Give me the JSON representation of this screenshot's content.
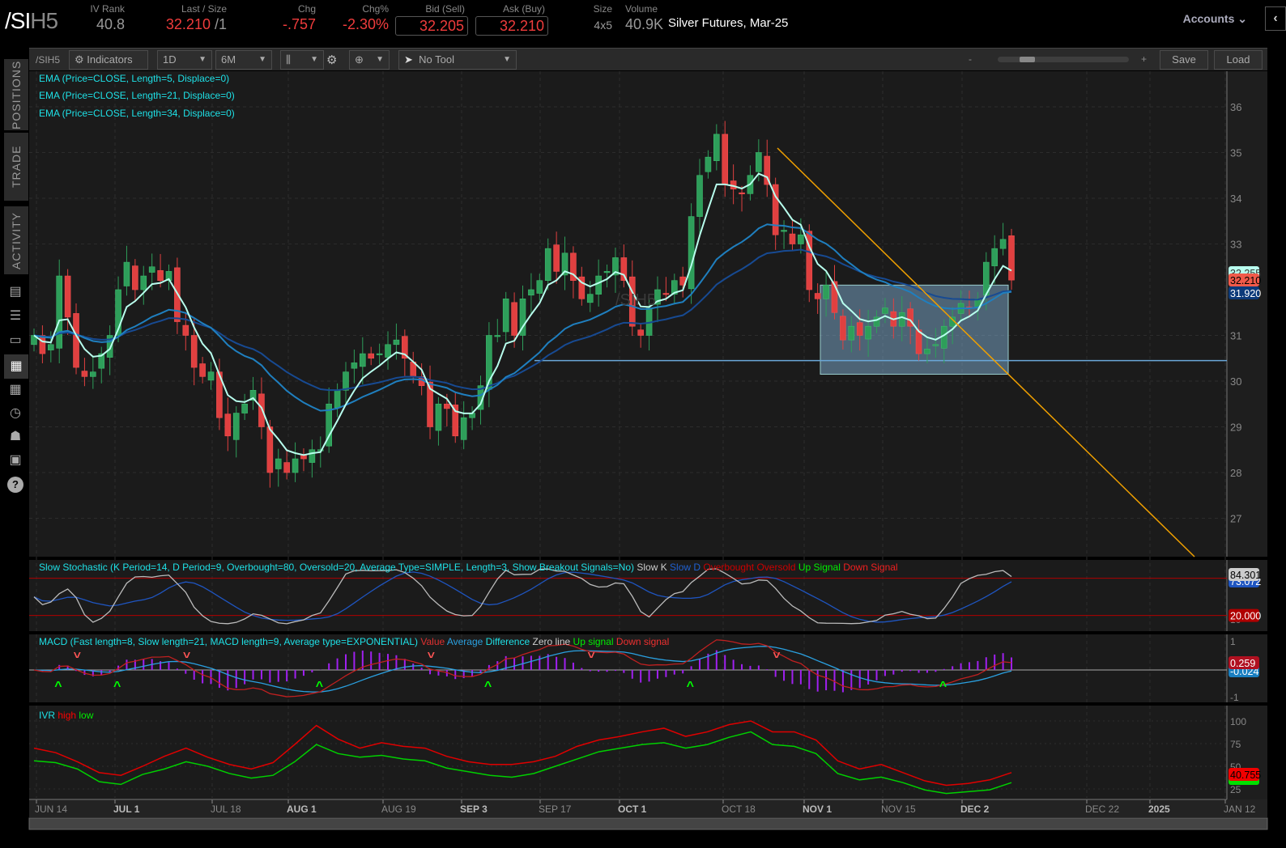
{
  "header": {
    "symbol_main": "/SI",
    "symbol_suffix": "H5",
    "fields": [
      {
        "label": "IV Rank",
        "value": "40.8"
      },
      {
        "label": "Last / Size",
        "value": "32.210",
        "size": "/1"
      },
      {
        "label": "Chg",
        "value": "-.757"
      },
      {
        "label": "Chg%",
        "value": "-2.30%"
      },
      {
        "label": "Bid (Sell)",
        "value": "32.205"
      },
      {
        "label": "Ask (Buy)",
        "value": "32.210"
      },
      {
        "label": "Size",
        "value": "4x5"
      },
      {
        "label": "Volume",
        "value": "40.9K"
      }
    ],
    "description": "Silver Futures, Mar-25",
    "accounts": "Accounts"
  },
  "sidebar": {
    "tabs": [
      "POSITIONS",
      "TRADE",
      "ACTIVITY"
    ],
    "icons": [
      "news-icon",
      "list-icon",
      "tv-icon",
      "chart-icon",
      "grid-icon",
      "clock-icon",
      "people-icon",
      "calendar-icon",
      "help-icon"
    ]
  },
  "toolbar": {
    "symbol": "/SIH5",
    "indicators": "Indicators",
    "period": "1D",
    "range": "6M",
    "tool": "No Tool",
    "zoom_minus": "-",
    "zoom_plus": "+",
    "save": "Save",
    "load": "Load",
    "zoom_level": 0.12
  },
  "studies": [
    "EMA (Price=CLOSE, Length=5, Displace=0)",
    "EMA (Price=CLOSE, Length=21, Displace=0)",
    "EMA (Price=CLOSE, Length=34, Displace=0)"
  ],
  "stoch": {
    "title": "Slow Stochastic (K Period=14, D Period=9, Overbought=80, Oversold=20, Average Type=SIMPLE, Length=3, Show Breakout Signals=No)",
    "legend": [
      "Slow K",
      "Slow D",
      "Overbought",
      "Oversold",
      "Up Signal",
      "Down Signal"
    ],
    "k_label": "84.301",
    "d_label": "73.072",
    "os_label": "20.000",
    "axis": [
      "10"
    ]
  },
  "macd": {
    "title": "MACD (Fast length=8, Slow length=21, MACD length=9, Average type=EXPONENTIAL)",
    "legend": [
      "Value",
      "Average",
      "Difference",
      "Zero line",
      "Up signal",
      "Down signal"
    ],
    "value_label": "0.259",
    "avg_label": "-0.024",
    "axis": [
      "1",
      "-1"
    ]
  },
  "ivr": {
    "legend": [
      "IVR",
      "high",
      "low"
    ],
    "label": "40.755",
    "axis": [
      "100",
      "75",
      "50",
      "25"
    ],
    "high": [
      70,
      65,
      55,
      43,
      40,
      50,
      61,
      70,
      60,
      52,
      47,
      54,
      74,
      95,
      80,
      70,
      76,
      72,
      70,
      61,
      55,
      52,
      52,
      55,
      61,
      72,
      79,
      83,
      88,
      92,
      83,
      88,
      96,
      100,
      88,
      88,
      79,
      56,
      47,
      52,
      43,
      34,
      29,
      31,
      35,
      43
    ],
    "low": [
      56,
      54,
      47,
      33,
      30,
      41,
      47,
      55,
      50,
      42,
      37,
      40,
      55,
      74,
      64,
      60,
      62,
      58,
      56,
      48,
      44,
      40,
      38,
      42,
      50,
      58,
      66,
      70,
      74,
      76,
      70,
      74,
      82,
      88,
      74,
      72,
      64,
      42,
      35,
      38,
      32,
      24,
      20,
      22,
      24,
      32
    ]
  },
  "watermark": "/SIH5",
  "price_axis": [
    "36",
    "35",
    "34",
    "33",
    "31",
    "30",
    "29",
    "28",
    "27"
  ],
  "price_labels": {
    "ema5": "32.255",
    "last": "32.210",
    "ema34": "31.920"
  },
  "x_axis": [
    {
      "t": "JUN 14",
      "b": false
    },
    {
      "t": "JUL 1",
      "b": true
    },
    {
      "t": "JUL 18",
      "b": false
    },
    {
      "t": "AUG 1",
      "b": true
    },
    {
      "t": "AUG 19",
      "b": false
    },
    {
      "t": "SEP 3",
      "b": true
    },
    {
      "t": "SEP 17",
      "b": false
    },
    {
      "t": "OCT 1",
      "b": true
    },
    {
      "t": "OCT 18",
      "b": false
    },
    {
      "t": "NOV 1",
      "b": true
    },
    {
      "t": "NOV 15",
      "b": false
    },
    {
      "t": "DEC 2",
      "b": true
    },
    {
      "t": "DEC 22",
      "b": false
    },
    {
      "t": "2025",
      "b": true
    },
    {
      "t": "JAN 12",
      "b": false
    }
  ],
  "colors": {
    "up": "#2e9e5a",
    "down": "#e04040",
    "ema5": "#b8ffee",
    "ema21": "#1f7fbf",
    "ema34": "#174a92",
    "trend": "#f0a000",
    "cyan": "#1ee0e6"
  },
  "chart_data": {
    "type": "candlestick",
    "title": "/SIH5 1D 6M",
    "ylim": [
      26.2,
      36.8
    ],
    "closes": [
      31.0,
      30.6,
      30.8,
      32.3,
      31.4,
      30.3,
      30.1,
      30.2,
      30.6,
      31.0,
      32.0,
      32.6,
      32.0,
      32.3,
      32.5,
      32.2,
      32.4,
      31.3,
      31.0,
      30.3,
      30.1,
      30.2,
      29.2,
      28.8,
      29.3,
      29.5,
      29.8,
      29.0,
      28.0,
      28.3,
      28.0,
      28.3,
      28.3,
      28.5,
      28.5,
      29.5,
      29.8,
      30.2,
      30.4,
      30.6,
      30.5,
      30.6,
      30.8,
      30.9,
      30.5,
      30.1,
      29.9,
      29.0,
      29.5,
      29.4,
      28.8,
      29.2,
      29.3,
      29.9,
      31.0,
      31.0,
      31.8,
      31.0,
      31.8,
      32.0,
      32.2,
      32.9,
      32.4,
      32.8,
      32.2,
      31.8,
      31.9,
      32.3,
      32.4,
      32.7,
      32.2,
      31.2,
      31.0,
      31.6,
      32.0,
      31.9,
      32.2,
      32.1,
      33.6,
      34.5,
      34.9,
      35.4,
      34.3,
      34.2,
      34.1,
      34.5,
      35.0,
      34.3,
      33.2,
      33.3,
      33.0,
      33.2,
      32.0,
      31.8,
      32.1,
      31.5,
      30.9,
      31.2,
      31.0,
      31.2,
      31.4,
      31.6,
      31.2,
      31.5,
      31.2,
      30.6,
      30.7,
      30.8,
      31.2,
      31.4,
      31.7,
      31.6,
      31.8,
      32.6,
      32.9,
      33.1,
      32.21
    ]
  }
}
